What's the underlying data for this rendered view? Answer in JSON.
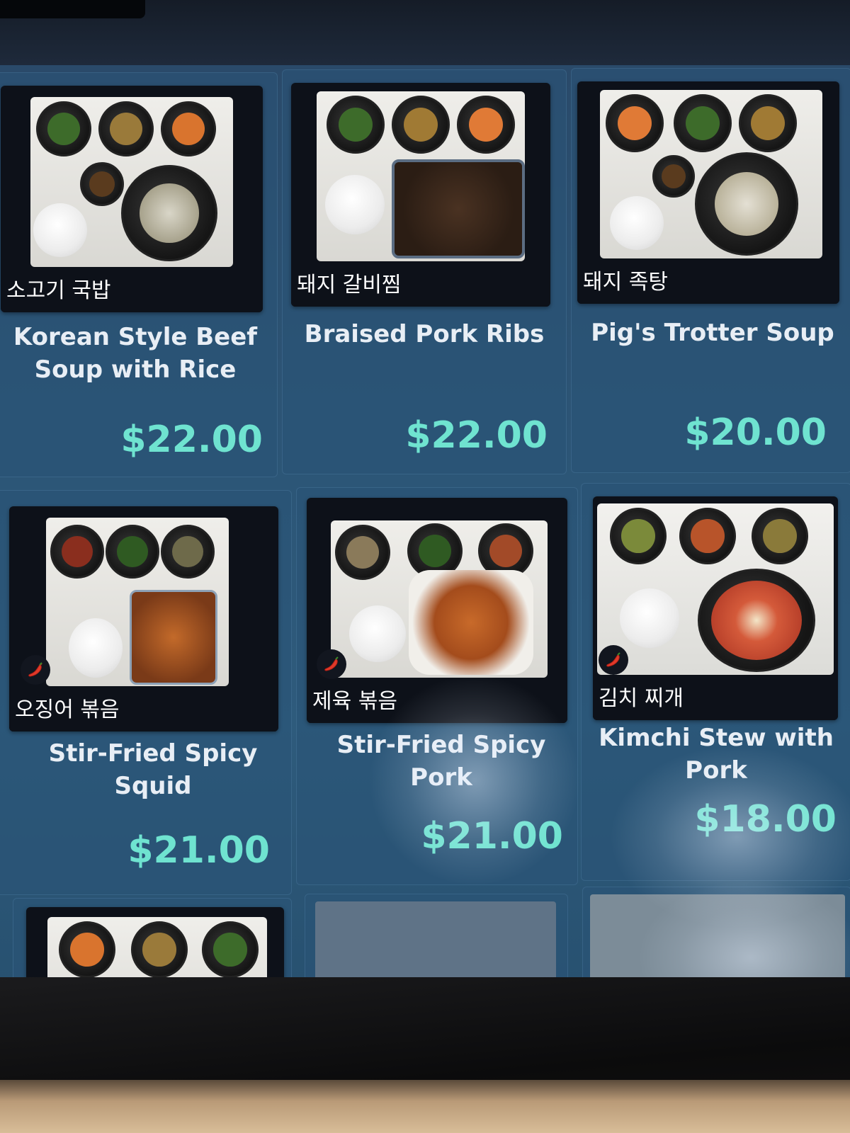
{
  "menu_items": [
    {
      "korean": "소고기 국밥",
      "english": "Korean Style Beef Soup with Rice",
      "price": "$22.00",
      "spicy": false
    },
    {
      "korean": "돼지 갈비찜",
      "english": "Braised Pork Ribs",
      "price": "$22.00",
      "spicy": false
    },
    {
      "korean": "돼지 족탕",
      "english": "Pig's Trotter Soup",
      "price": "$20.00",
      "spicy": false
    },
    {
      "korean": "오징어 볶음",
      "english": "Stir-Fried Spicy Squid",
      "price": "$21.00",
      "spicy": true
    },
    {
      "korean": "제육 볶음",
      "english": "Stir-Fried Spicy Pork",
      "price": "$21.00",
      "spicy": true
    },
    {
      "korean": "김치 찌개",
      "english": "Kimchi Stew with Pork",
      "price": "$18.00",
      "spicy": true
    }
  ],
  "colors": {
    "price": "#6fe3d0",
    "tile_background": "#0d1119",
    "screen_background": "#2c5576",
    "english_text": "#e8eef5"
  },
  "icons": {
    "spicy": "chili-pepper-icon"
  }
}
